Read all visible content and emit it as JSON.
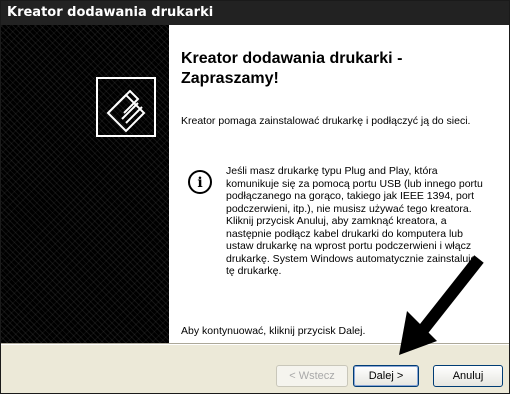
{
  "window": {
    "title": "Kreator dodawania drukarki"
  },
  "content": {
    "heading": "Kreator dodawania drukarki - Zapraszamy!",
    "intro": "Kreator pomaga zainstalować drukarkę i podłączyć ją do sieci.",
    "info": "Jeśli masz drukarkę typu Plug and Play, która komunikuje się za pomocą portu USB (lub innego portu podłączanego na gorąco, takiego jak IEEE 1394, port podczerwieni, itp.), nie musisz używać tego kreatora. Kliknij przycisk Anuluj, aby zamknąć kreatora, a następnie podłącz kabel drukarki do komputera lub ustaw drukarkę na wprost portu podczerwieni i włącz drukarkę. System Windows automatycznie zainstaluje tę drukarkę.",
    "continue_text": "Aby kontynuować, kliknij przycisk Dalej."
  },
  "buttons": {
    "back": "< Wstecz",
    "next": "Dalej >",
    "cancel": "Anuluj"
  },
  "icons": {
    "side": "printer-wizard-icon",
    "info": "info-icon",
    "pointer": "arrow-pointer-icon"
  }
}
